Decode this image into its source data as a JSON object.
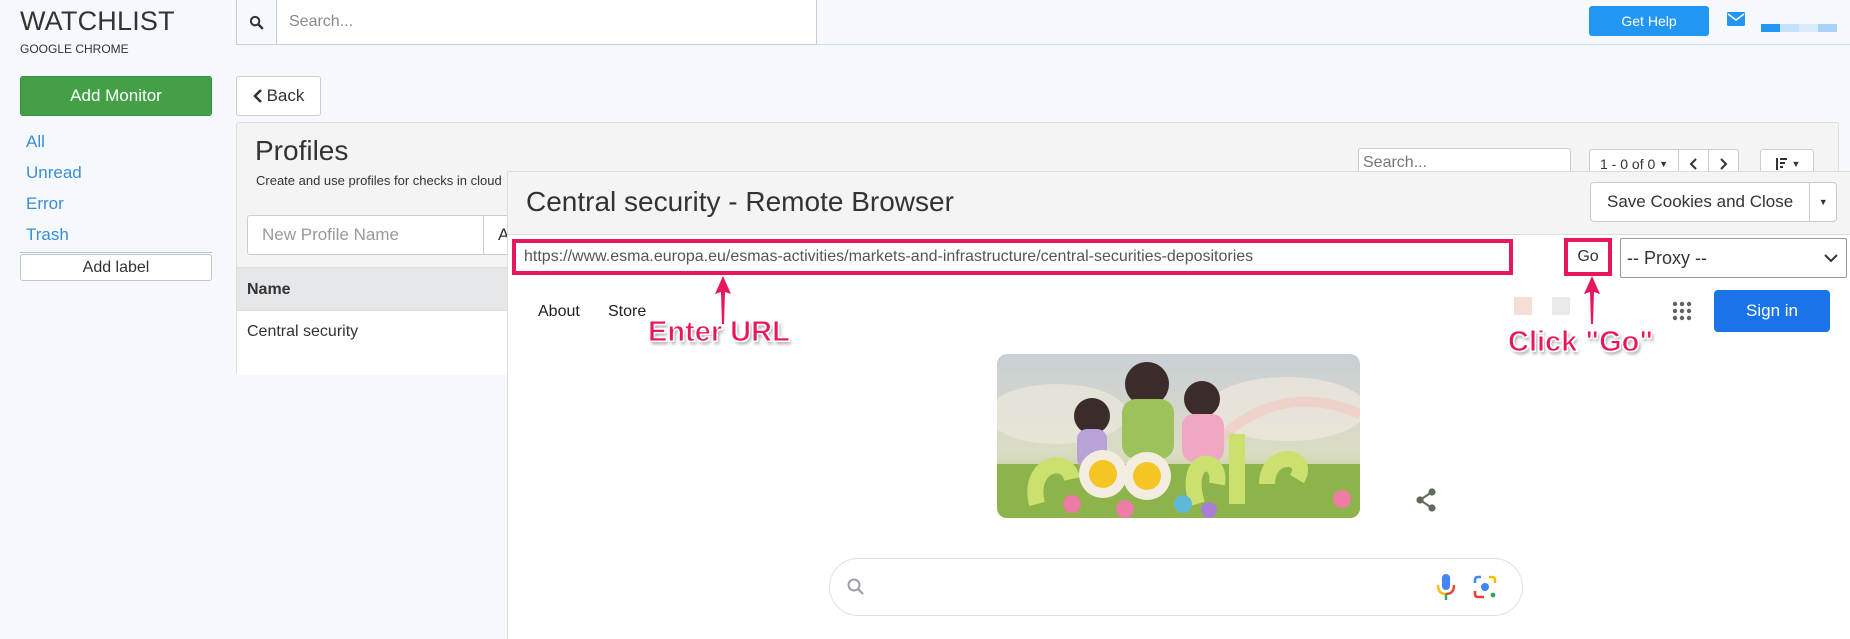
{
  "sidebar": {
    "brand_title": "WATCHLIST",
    "brand_subtitle": "GOOGLE CHROME",
    "add_monitor_label": "Add Monitor",
    "nav_items": [
      {
        "label": "All"
      },
      {
        "label": "Unread"
      },
      {
        "label": "Error"
      },
      {
        "label": "Trash"
      }
    ],
    "add_label_button": "Add label"
  },
  "topbar": {
    "search_placeholder": "Search...",
    "get_help_label": "Get Help",
    "mail_icon": "envelope-icon",
    "usage_colors": [
      "#2196f3",
      "#c5e1f9",
      "#d8ebfb",
      "#a9d2f6"
    ]
  },
  "back_label": "Back",
  "profiles_panel": {
    "title": "Profiles",
    "subtitle": "Create and use profiles for checks in cloud",
    "search_placeholder": "Search...",
    "pager_label": "1 - 0 of 0",
    "new_profile_placeholder": "New Profile Name",
    "add_button_partial": "A",
    "table": {
      "columns": [
        "Name"
      ],
      "rows": [
        [
          "Central security"
        ]
      ]
    }
  },
  "modal": {
    "title": "Central security - Remote Browser",
    "save_button_label": "Save Cookies and Close",
    "url_value": "https://www.esma.europa.eu/esmas-activities/markets-and-infrastructure/central-securities-depositories",
    "go_label": "Go",
    "proxy_selected": "-- Proxy --",
    "remote_page": {
      "links": [
        "About",
        "Store"
      ],
      "signin_label": "Sign in",
      "search_value": ""
    }
  },
  "annotations": {
    "enter_url": "Enter URL",
    "click_go": "Click \"Go\"",
    "color": "#e8175d"
  }
}
